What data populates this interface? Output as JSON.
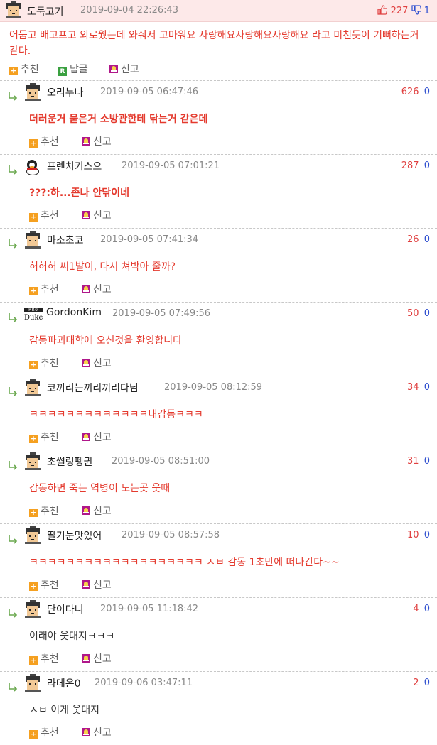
{
  "post": {
    "nickname": "도둑고기",
    "datetime": "2019-09-04 22:26:43",
    "upvotes": "227",
    "downvotes": "1",
    "text": "어둠고 배고프고 외로웠는데 와줘서 고마워요 사랑해요사랑해요사랑해요 라고 미친듯이 기뻐하는거 같다.",
    "actions": {
      "recommend": "추천",
      "reply": "답글",
      "report": "신고"
    }
  },
  "icons": {
    "thumbs_up": "thumbs-up-icon",
    "thumbs_down": "thumbs-down-icon",
    "recommend": "plus-icon",
    "reply": "reply-r-icon",
    "report": "siren-icon",
    "reply_arrow": "reply-arrow-icon"
  },
  "colors": {
    "header_bg": "#fde9e9",
    "comment_text": "#e43a2e",
    "up": "#e04040",
    "down": "#3050d0"
  },
  "comments": [
    {
      "nickname": "오리누나",
      "datetime": "2019-09-05 06:47:46",
      "up": "626",
      "down": "0",
      "text": "더러운거 묻은거 소방관한테 닦는거 같은데",
      "avatar": "pixel-man",
      "bold": true,
      "dark": false
    },
    {
      "nickname": "프렌치키스으",
      "datetime": "2019-09-05 07:01:21",
      "up": "287",
      "down": "0",
      "text": "???:하...존나 안닦이네",
      "avatar": "penguin",
      "bold": true,
      "dark": false
    },
    {
      "nickname": "마조초코",
      "datetime": "2019-09-05 07:41:34",
      "up": "26",
      "down": "0",
      "text": "허허허 씨1발이, 다시 쳐박아 줄까?",
      "avatar": "pixel-man",
      "bold": false,
      "dark": false
    },
    {
      "nickname": "GordonKim",
      "datetime": "2019-09-05 07:49:56",
      "up": "50",
      "down": "0",
      "text": "감동파괴대학에 오신것을 환영합니다",
      "avatar": "duke",
      "avatar_top": "PRO",
      "avatar_name": "Duke",
      "bold": false,
      "dark": false
    },
    {
      "nickname": "코끼리는끼리끼리다님",
      "datetime": "2019-09-05 08:12:59",
      "up": "34",
      "down": "0",
      "text": "ㅋㅋㅋㅋㅋㅋㅋㅋㅋㅋㅋㅋㅋ내감동ㅋㅋㅋ",
      "avatar": "pixel-man",
      "bold": false,
      "dark": false
    },
    {
      "nickname": "초썰렁펭귄",
      "datetime": "2019-09-05 08:51:00",
      "up": "31",
      "down": "0",
      "text": "감동하면 죽는 역병이 도는곳 웃때",
      "avatar": "pixel-man",
      "bold": false,
      "dark": false
    },
    {
      "nickname": "딸기눈맛있어",
      "datetime": "2019-09-05 08:57:58",
      "up": "10",
      "down": "0",
      "text": "ㅋㅋㅋㅋㅋㅋㅋㅋㅋㅋㅋㅋㅋㅋㅋㅋㅋㅋㅋ ㅅㅂ 감동 1초만에 떠나간다~~",
      "avatar": "pixel-man",
      "bold": false,
      "dark": false
    },
    {
      "nickname": "단이다니",
      "datetime": "2019-09-05 11:18:42",
      "up": "4",
      "down": "0",
      "text": "이래야 웃대지ㅋㅋㅋ",
      "avatar": "pixel-man",
      "bold": false,
      "dark": true
    },
    {
      "nickname": "라데온0",
      "datetime": "2019-09-06 03:47:11",
      "up": "2",
      "down": "0",
      "text": "ㅅㅂ 이게 웃대지",
      "avatar": "pixel-man",
      "bold": false,
      "dark": true
    }
  ],
  "comment_actions": {
    "recommend": "추천",
    "report": "신고"
  }
}
